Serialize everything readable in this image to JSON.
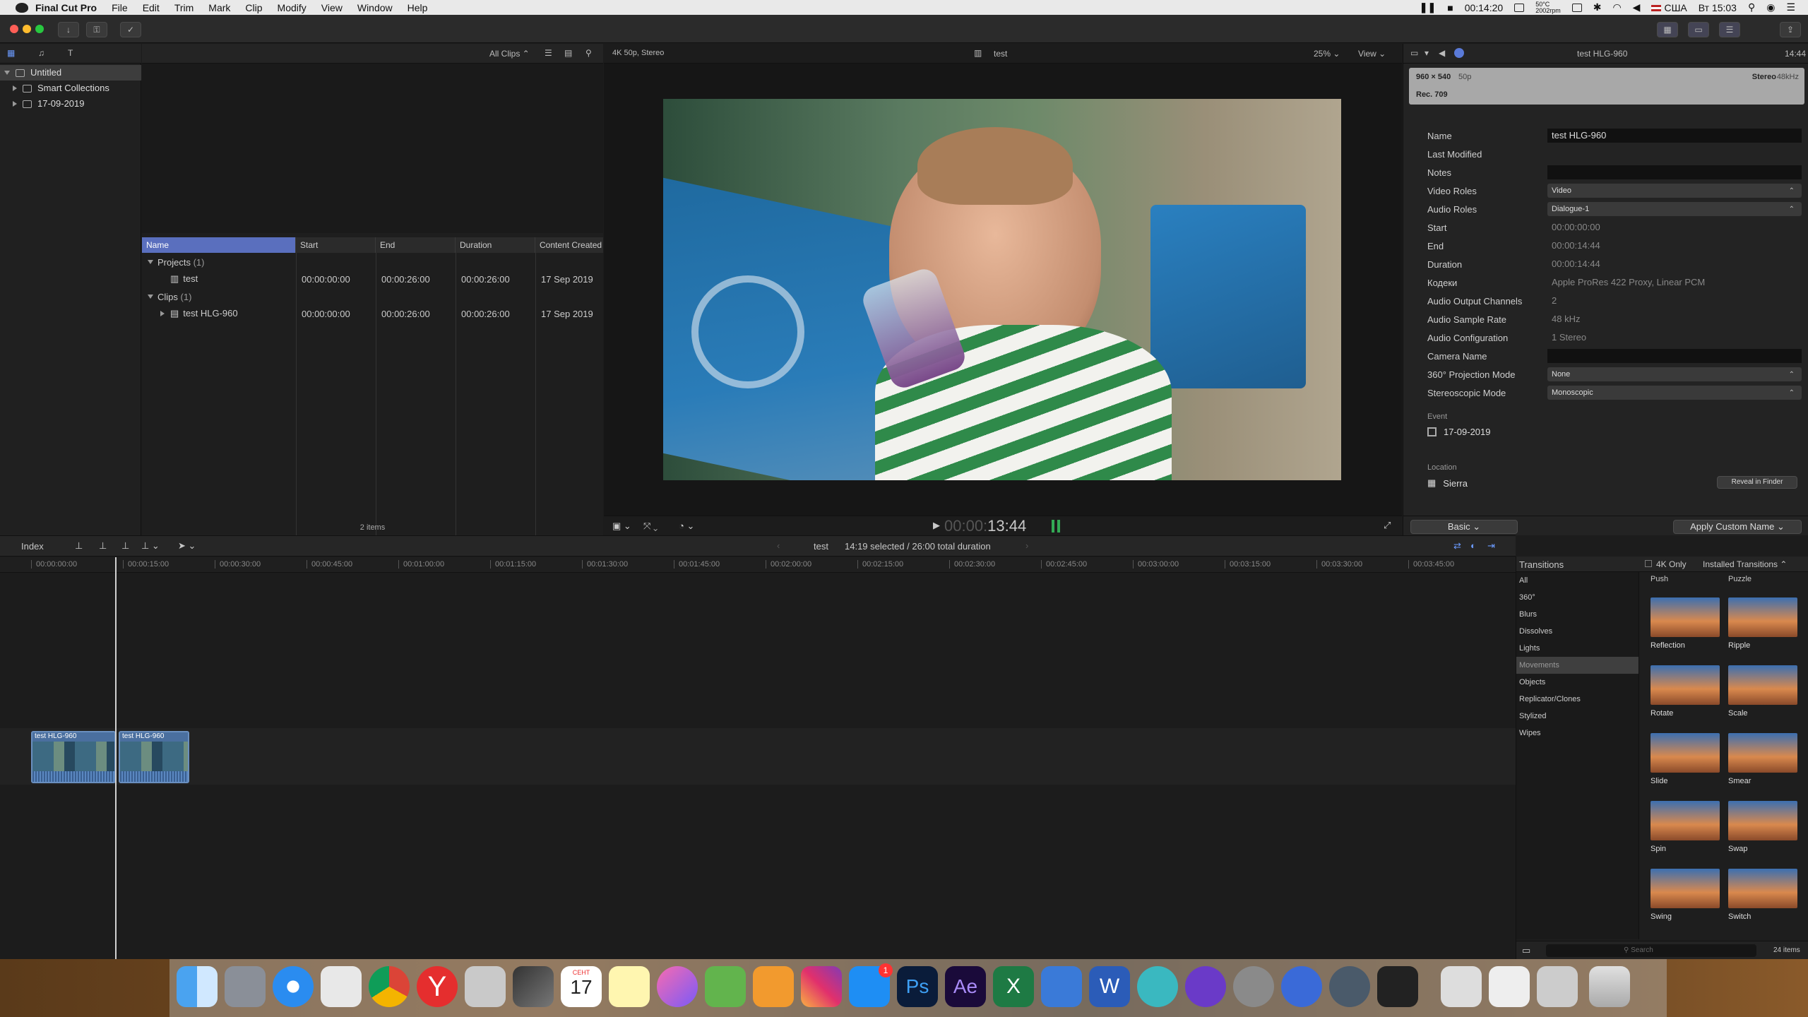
{
  "menubar": {
    "app_name": "Final Cut Pro",
    "items": [
      "File",
      "Edit",
      "Trim",
      "Mark",
      "Clip",
      "Modify",
      "View",
      "Window",
      "Help"
    ],
    "time": "00:14:20",
    "temp": "50°C",
    "rpm": "2002rpm",
    "input_source": "США",
    "clock": "Вт 15:03"
  },
  "library": {
    "items": [
      {
        "label": "Untitled"
      },
      {
        "label": "Smart Collections"
      },
      {
        "label": "17-09-2019"
      }
    ]
  },
  "browser": {
    "filter_label": "All Clips",
    "columns": [
      "Name",
      "Start",
      "End",
      "Duration",
      "Content Created"
    ],
    "groups": [
      {
        "label": "Projects",
        "count": "(1)"
      },
      {
        "label": "Clips",
        "count": "(1)"
      }
    ],
    "rows": [
      {
        "name": "test",
        "start": "00:00:00:00",
        "end": "00:00:26:00",
        "duration": "00:00:26:00",
        "created": "17 Sep 2019"
      },
      {
        "name": "test HLG-960",
        "start": "00:00:00:00",
        "end": "00:00:26:00",
        "duration": "00:00:26:00",
        "created": "17 Sep 2019"
      }
    ],
    "item_count": "2 items"
  },
  "viewer": {
    "format": "4K 50p, Stereo",
    "title": "test",
    "zoom": "25%",
    "view_label": "View",
    "timecode_dim": "00:00:",
    "timecode": "13:44"
  },
  "inspector": {
    "clip_name": "test HLG-960",
    "duration_top": "14:44",
    "resolution": "960 × 540",
    "fps": "50p",
    "color_space": "Rec. 709",
    "audio": "Stereo",
    "sample": "48kHz",
    "fields": [
      {
        "label": "Name",
        "value": "test HLG-960",
        "kind": "fld"
      },
      {
        "label": "Last Modified",
        "value": "",
        "kind": "txt"
      },
      {
        "label": "Notes",
        "value": "",
        "kind": "fld"
      },
      {
        "label": "Video Roles",
        "value": "Video",
        "kind": "sel"
      },
      {
        "label": "Audio Roles",
        "value": "Dialogue-1",
        "kind": "sel"
      },
      {
        "label": "Start",
        "value": "00:00:00:00",
        "kind": "txt"
      },
      {
        "label": "End",
        "value": "00:00:14:44",
        "kind": "txt"
      },
      {
        "label": "Duration",
        "value": "00:00:14:44",
        "kind": "txt"
      },
      {
        "label": "Кодеки",
        "value": "Apple ProRes 422 Proxy, Linear PCM",
        "kind": "txt"
      },
      {
        "label": "Audio Output Channels",
        "value": "2",
        "kind": "txt"
      },
      {
        "label": "Audio Sample Rate",
        "value": "48 kHz",
        "kind": "txt"
      },
      {
        "label": "Audio Configuration",
        "value": "1 Stereo",
        "kind": "txt"
      },
      {
        "label": "Camera Name",
        "value": "",
        "kind": "fld"
      },
      {
        "label": "360° Projection Mode",
        "value": "None",
        "kind": "sel"
      },
      {
        "label": "Stereoscopic Mode",
        "value": "Monoscopic",
        "kind": "sel"
      }
    ],
    "event_label": "Event",
    "event_value": "17-09-2019",
    "location_label": "Location",
    "location_value": "Sierra",
    "reveal_button": "Reveal in Finder",
    "basic_button": "Basic",
    "apply_button": "Apply Custom Name"
  },
  "timeline": {
    "index_label": "Index",
    "project_name": "test",
    "selection_info": "14:19 selected / 26:00 total duration",
    "ruler": [
      "00:00:00:00",
      "00:00:15:00",
      "00:00:30:00",
      "00:00:45:00",
      "00:01:00:00",
      "00:01:15:00",
      "00:01:30:00",
      "00:01:45:00",
      "00:02:00:00",
      "00:02:15:00",
      "00:02:30:00",
      "00:02:45:00",
      "00:03:00:00",
      "00:03:15:00",
      "00:03:30:00",
      "00:03:45:00"
    ],
    "clips": [
      {
        "label": "test HLG-960"
      },
      {
        "label": "test HLG-960"
      }
    ]
  },
  "transitions": {
    "title": "Transitions",
    "filter_4k": "4K Only",
    "installed": "Installed Transitions",
    "categories": [
      "All",
      "360°",
      "Blurs",
      "Dissolves",
      "Lights",
      "Movements",
      "Objects",
      "Replicator/Clones",
      "Stylized",
      "Wipes"
    ],
    "active_category": "Movements",
    "header_items": [
      "Push",
      "Puzzle"
    ],
    "items": [
      "Reflection",
      "Ripple",
      "Rotate",
      "Scale",
      "Slide",
      "Smear",
      "Spin",
      "Swap",
      "Swing",
      "Switch"
    ],
    "search_placeholder": "Search",
    "count": "24 items"
  },
  "dock": {
    "calendar_month": "СЕНТ",
    "calendar_day": "17",
    "appstore_badge": "1"
  }
}
